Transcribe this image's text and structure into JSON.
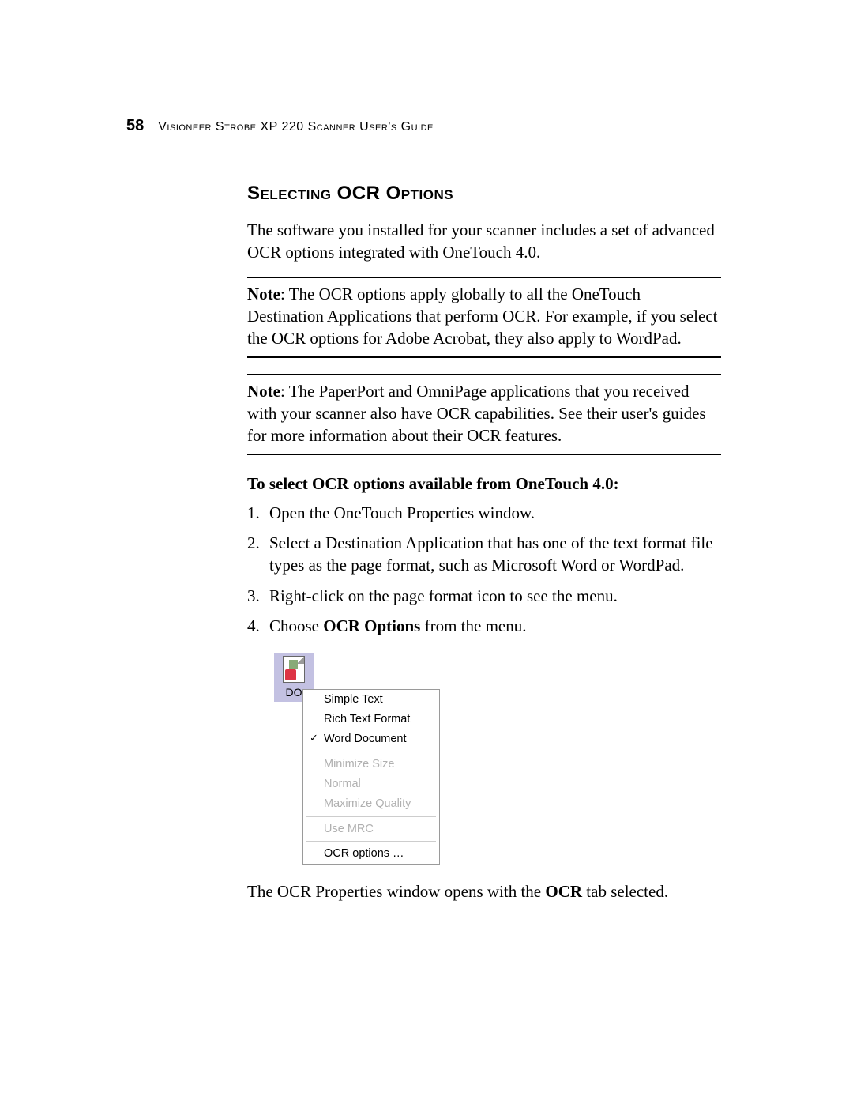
{
  "pageNumber": "58",
  "headerText": "Visioneer Strobe XP 220 Scanner User's Guide",
  "heading": "Selecting OCR Options",
  "intro": "The software you installed for your scanner includes a set of advanced OCR options integrated with OneTouch 4.0.",
  "note1Label": "Note",
  "note1": ":  The OCR options apply globally to all the OneTouch Destination Applications that perform OCR. For example, if you select the OCR options for Adobe Acrobat, they also apply to WordPad.",
  "note2Label": "Note",
  "note2": ":  The PaperPort and OmniPage applications that you received with your scanner also have OCR capabilities. See their user's guides for more information about their OCR features.",
  "subHeading": "To select OCR options available from OneTouch 4.0:",
  "steps": {
    "s1": "Open the OneTouch Properties window.",
    "s2": "Select a Destination Application that has one of the text format file types as the page format, such as Microsoft Word or WordPad.",
    "s3": "Right-click on the page format icon to see the menu.",
    "s4a": "Choose ",
    "s4b": "OCR Options",
    "s4c": " from the menu."
  },
  "iconLabel": "DO",
  "menu": {
    "simpleText": "Simple Text",
    "richText": "Rich Text Format",
    "wordDoc": "Word Document",
    "minSize": "Minimize Size",
    "normal": "Normal",
    "maxQuality": "Maximize Quality",
    "useMrc": "Use MRC",
    "ocrOptions": "OCR options …"
  },
  "closingA": "The OCR Properties window opens with the ",
  "closingB": "OCR",
  "closingC": " tab selected."
}
